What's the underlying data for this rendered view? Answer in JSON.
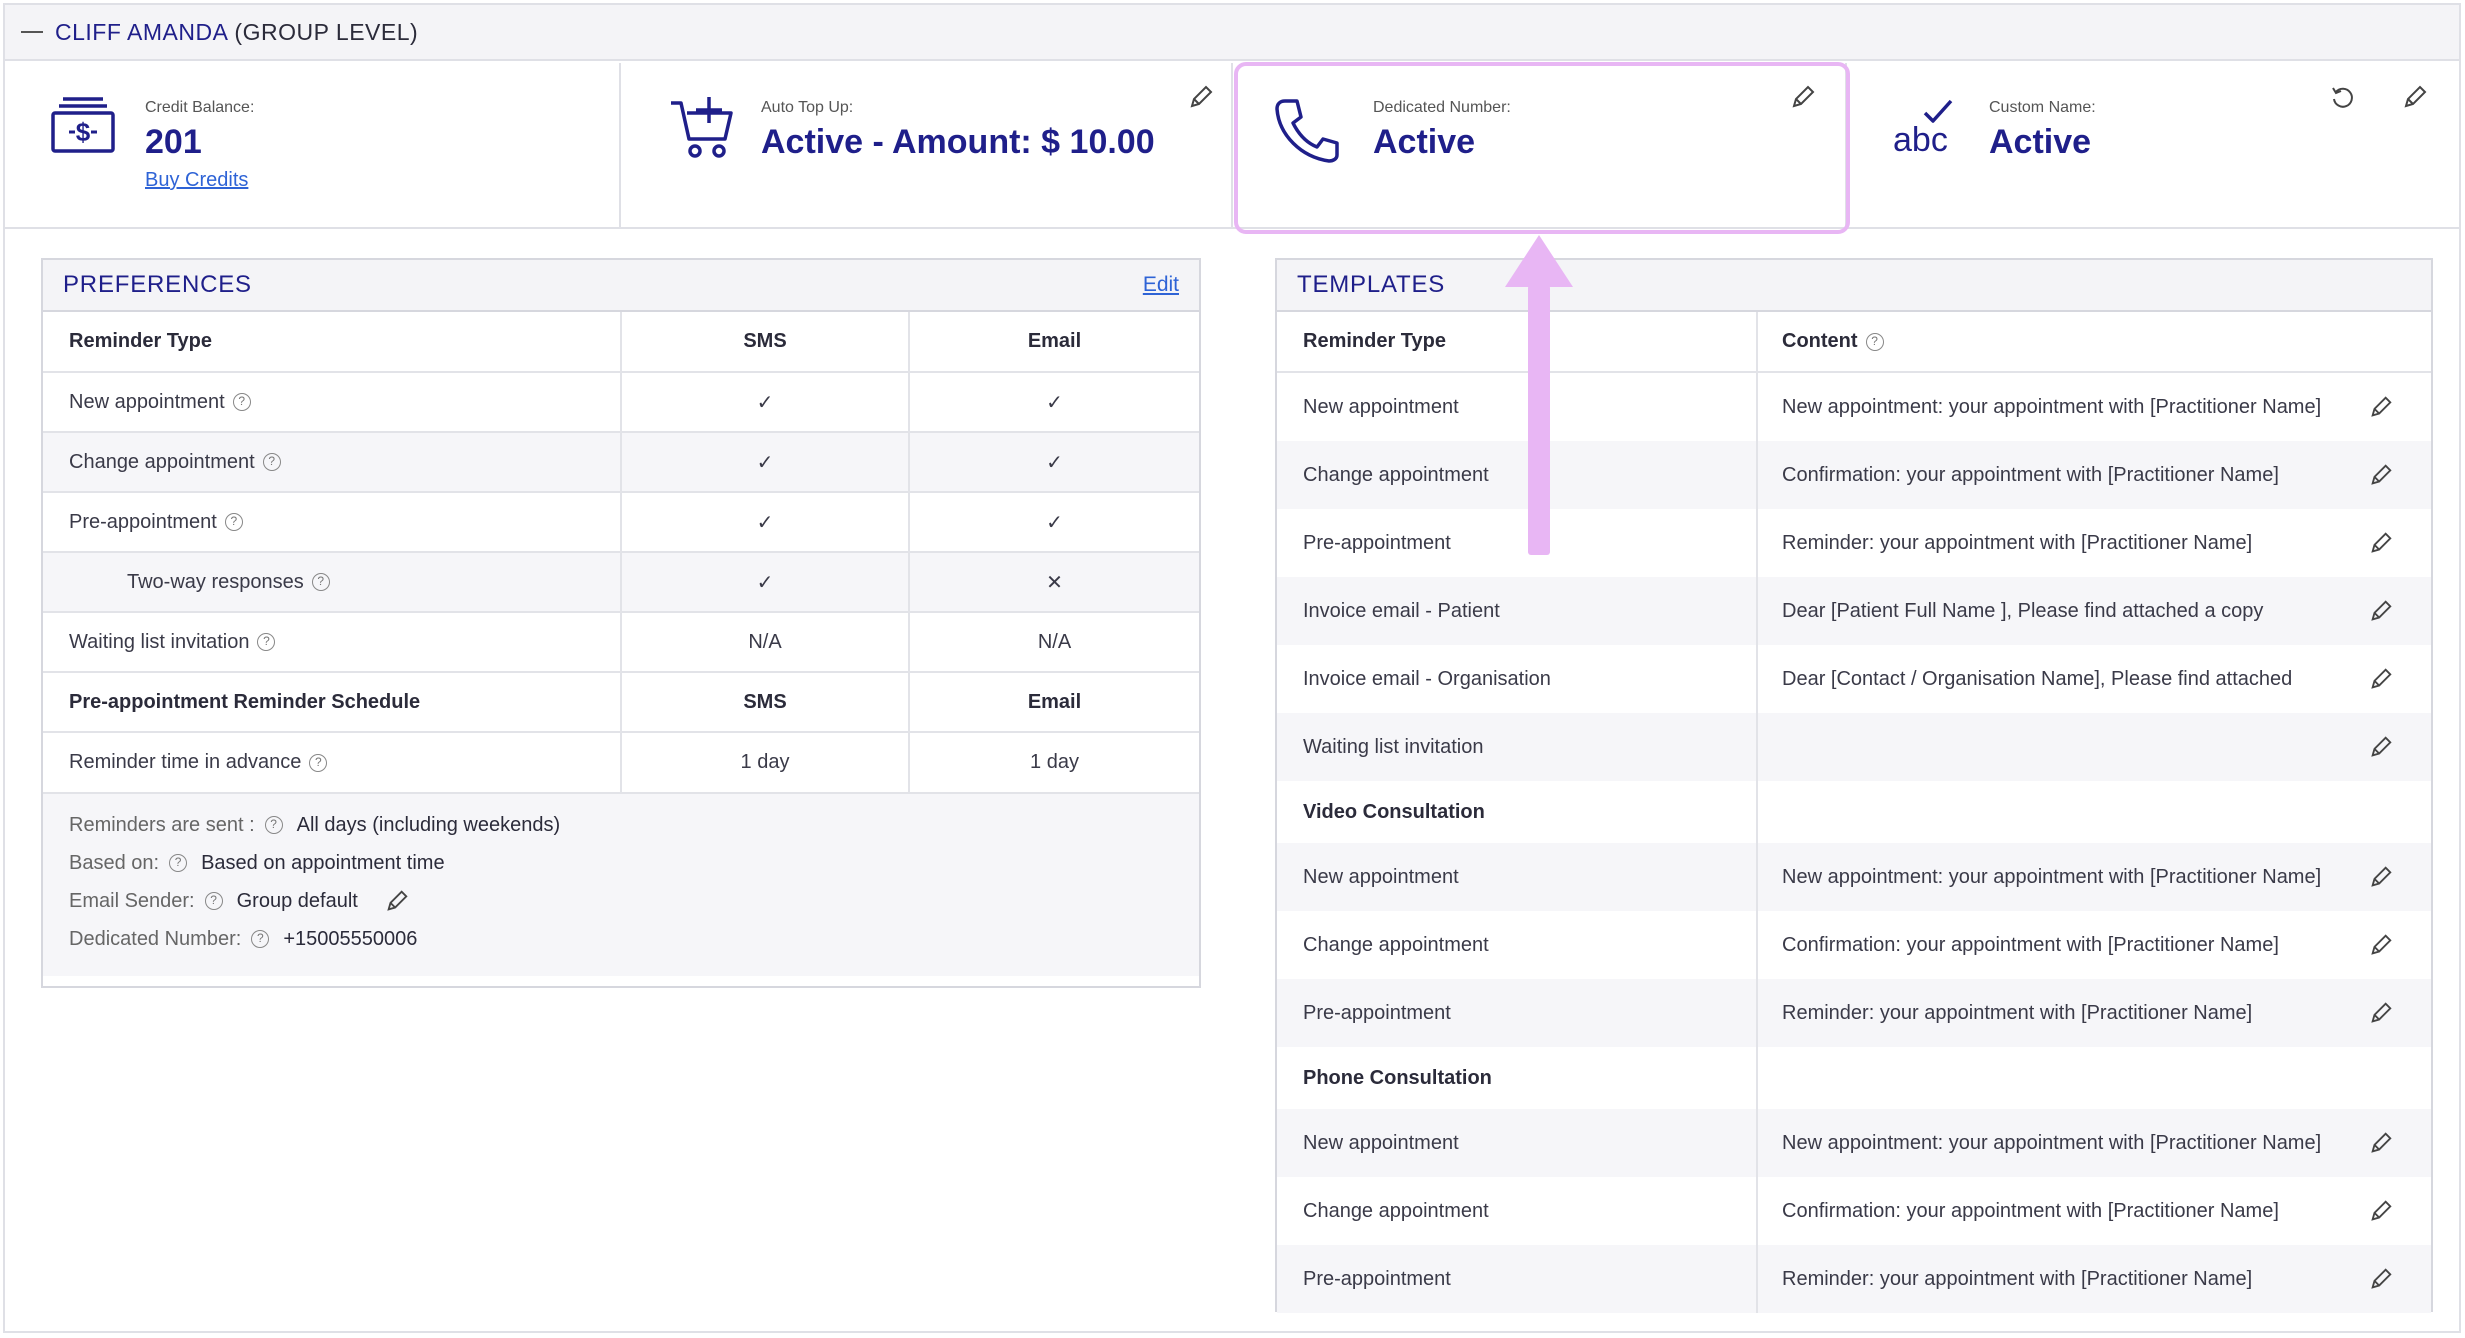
{
  "header": {
    "name": "CLIFF AMANDA",
    "level": "(GROUP LEVEL)"
  },
  "stats": {
    "credit": {
      "label": "Credit Balance:",
      "value": "201",
      "link": "Buy Credits",
      "icon": "money-icon"
    },
    "topup": {
      "label": "Auto Top Up:",
      "value": "Active - Amount: $ 10.00",
      "icon": "cart-plus-icon"
    },
    "dedicated": {
      "label": "Dedicated Number:",
      "value": "Active",
      "icon": "phone-icon"
    },
    "custom": {
      "label": "Custom Name:",
      "value": "Active",
      "icon": "abc-check-icon"
    }
  },
  "preferences": {
    "title": "PREFERENCES",
    "edit": "Edit",
    "columns": [
      "Reminder Type",
      "SMS",
      "Email"
    ],
    "rows": [
      {
        "label": "New appointment",
        "sms": "✓",
        "email": "✓"
      },
      {
        "label": "Change appointment",
        "sms": "✓",
        "email": "✓"
      },
      {
        "label": "Pre-appointment",
        "sms": "✓",
        "email": "✓"
      },
      {
        "label": "Two-way responses",
        "sms": "✓",
        "email": "✕"
      },
      {
        "label": "Waiting list invitation",
        "sms": "N/A",
        "email": "N/A"
      }
    ],
    "schedule_columns": [
      "Pre-appointment Reminder Schedule",
      "SMS",
      "Email"
    ],
    "schedule_row": {
      "label": "Reminder time in advance",
      "sms": "1 day",
      "email": "1 day"
    },
    "footer": {
      "sent_label": "Reminders are sent :",
      "sent_value": "All days (including weekends)",
      "based_label": "Based on:",
      "based_value": "Based on appointment time",
      "sender_label": "Email Sender:",
      "sender_value": "Group default",
      "number_label": "Dedicated Number:",
      "number_value": "+15005550006"
    }
  },
  "templates": {
    "title": "TEMPLATES",
    "columns": [
      "Reminder Type",
      "Content"
    ],
    "rows": [
      {
        "type": "New appointment",
        "content": "New appointment: your appointment with [Practitioner Name]"
      },
      {
        "type": "Change appointment",
        "content": "Confirmation: your appointment with [Practitioner Name]"
      },
      {
        "type": "Pre-appointment",
        "content": "Reminder: your appointment with [Practitioner Name]"
      },
      {
        "type": "Invoice email - Patient",
        "content": "Dear [Patient Full Name ], Please find attached a copy"
      },
      {
        "type": "Invoice email - Organisation",
        "content": "Dear [Contact / Organisation Name], Please find attached"
      },
      {
        "type": "Waiting list invitation",
        "content": ""
      }
    ],
    "video_section": "Video Consultation",
    "video_rows": [
      {
        "type": "New appointment",
        "content": "New appointment: your appointment with [Practitioner Name]"
      },
      {
        "type": "Change appointment",
        "content": "Confirmation: your appointment with [Practitioner Name]"
      },
      {
        "type": "Pre-appointment",
        "content": "Reminder: your appointment with [Practitioner Name]"
      }
    ],
    "phone_section": "Phone Consultation",
    "phone_rows": [
      {
        "type": "New appointment",
        "content": "New appointment: your appointment with [Practitioner Name]"
      },
      {
        "type": "Change appointment",
        "content": "Confirmation: your appointment with [Practitioner Name]"
      },
      {
        "type": "Pre-appointment",
        "content": "Reminder: your appointment with [Practitioner Name]"
      }
    ]
  },
  "colors": {
    "brand": "#1f1f8a",
    "link": "#2e63d6",
    "highlight": "#e8b6f4"
  }
}
